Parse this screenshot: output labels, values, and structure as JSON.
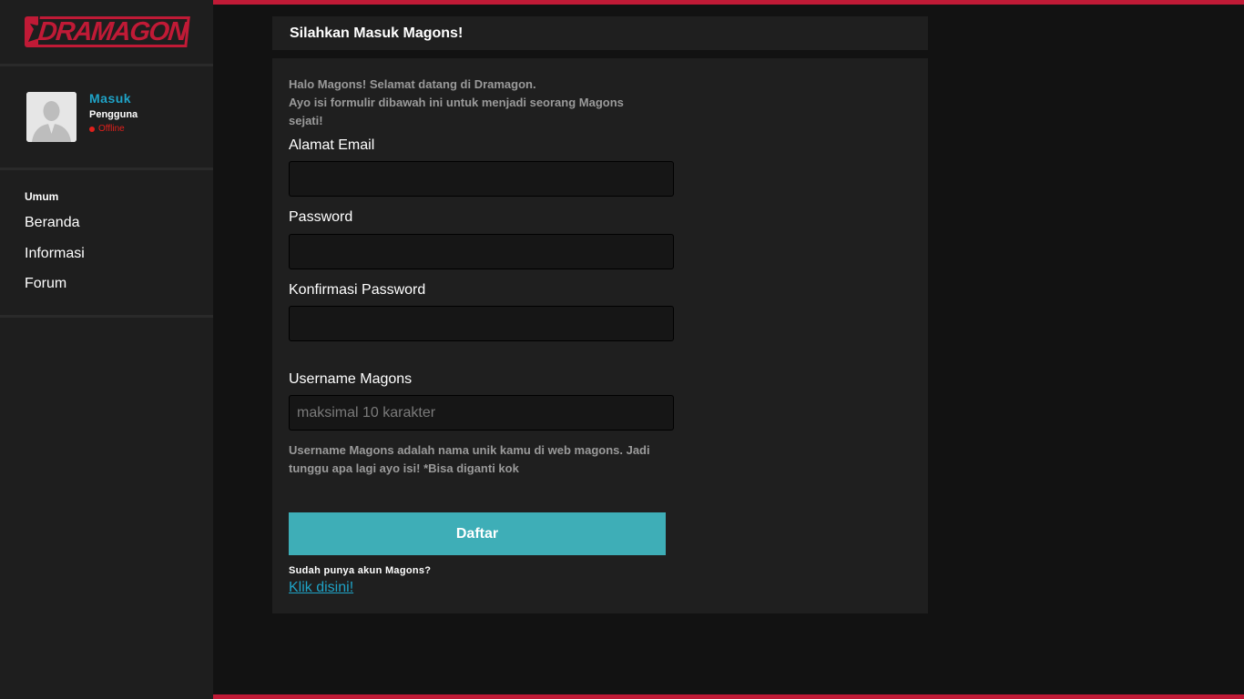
{
  "brand": {
    "logo_text": "DRAMAGON",
    "accent": "#c01a36",
    "link_color": "#1fa3c7",
    "button_color": "#3eaeb7"
  },
  "user": {
    "name": "Masuk",
    "role": "Pengguna",
    "status": "Offline",
    "avatar_icon": "user-avatar-placeholder"
  },
  "nav": {
    "heading": "Umum",
    "items": [
      {
        "label": "Beranda"
      },
      {
        "label": "Informasi"
      },
      {
        "label": "Forum"
      }
    ]
  },
  "header": {
    "title": "Silahkan Masuk Magons!"
  },
  "form": {
    "intro_line1": "Halo Magons! Selamat datang di Dramagon.",
    "intro_line2": "Ayo isi formulir dibawah ini untuk menjadi seorang Magons sejati!",
    "email_label": "Alamat Email",
    "email_value": "",
    "password_label": "Password",
    "password_value": "",
    "confirm_label": "Konfirmasi Password",
    "confirm_value": "",
    "username_label": "Username Magons",
    "username_placeholder": "maksimal 10 karakter",
    "username_help": "Username Magons adalah nama unik kamu di web magons. Jadi tunggu apa lagi ayo isi! *Bisa diganti kok",
    "submit_label": "Daftar",
    "have_account": "Sudah punya akun Magons?",
    "login_link": "Klik disini!"
  }
}
